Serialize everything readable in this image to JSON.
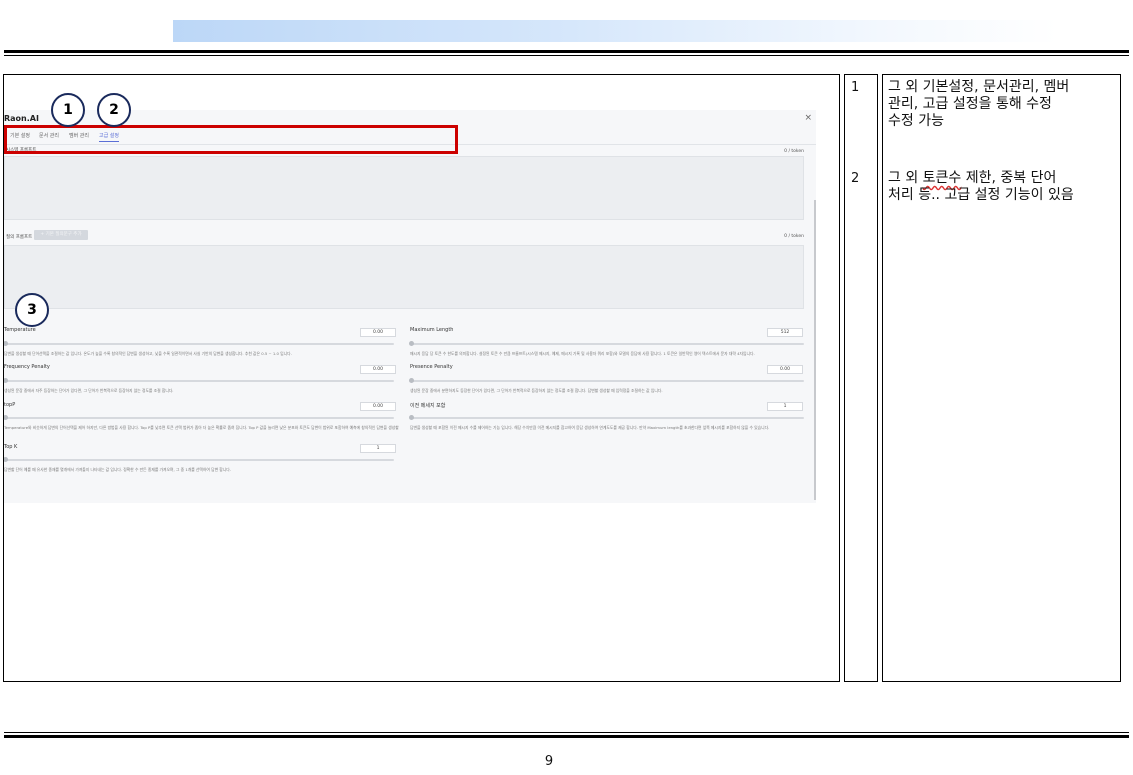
{
  "page_number": "9",
  "screenshot": {
    "app_title": "Raon.AI",
    "close_glyph": "×",
    "tabs": [
      "기본 설정",
      "문서 관리",
      "멤버 관리",
      "고급 설정"
    ],
    "active_tab_index": 3,
    "system_prompt_label": "시스템 프롬프트",
    "system_prompt_tokens": "0 / token",
    "user_prompt_label": "질의 프롬프트",
    "user_prompt_button": "+ 기본 질의문구 추가",
    "user_prompt_tokens": "0 / token",
    "params": [
      {
        "label": "Temperature",
        "value": "0.00",
        "desc": "답변을 생성할 때 단어선택을 조절하는 값 입니다. 온도가 높을 수록 창의적인 답변을 생성하고, 낮을 수록 일관적이면서 사실 기반의 답변을 생성합니다. 추천 값은 0.5 ~ 1.0 입니다."
      },
      {
        "label": "Maximum Length",
        "value": "512",
        "desc": "매시지 응답 당 토큰 수 한도를 의미합니다. 설정된 토큰 수 만큼 프롬프트(시스템 메시지, 예제, 메시지 기록 및 사용자 쿼리 포함)와 모델의 응답에 사용 합니다. 1 토큰은 일반적인 영어 텍스트에서 문자 대략 4자입니다."
      },
      {
        "label": "Frequency Penalty",
        "value": "0.00",
        "desc": "생성된 문장 중에서 자주 등장하는 단어가 있다면, 그 단어가 반복적으로 등장하지 않는 정도를 조절 합니다."
      },
      {
        "label": "Presence Penalty",
        "value": "0.00",
        "desc": "생성된 문장 중에서 분면하지도 등장한 단어가 있다면, 그 단어가 반복적으로 등장하지 않는 정도를 조절 합니다. 답변할 생성할 때 입력정을 조절하는 값 입니다."
      },
      {
        "label": "topP",
        "value": "0.00",
        "desc": "Temperature와 비슷하게 답변의 단어선택을 제어 하지만, 다른 방법을 사용 합니다. Top P를 낮추면 토큰 선택 범위가 좁아 더 높은 확률로 좁혀 집니다. Top P 값을 늘리면 낮은 분포와 토큰도 답변이 범위로 포함하여 예측에 창의적인 답변을 생성할 수 있습니다."
      },
      {
        "label": "이전 메세지 포함",
        "value": "1",
        "desc": "답변을 생성할 때 포함된 이전 메시지 수를 제어하는 기능 입니다. 해당 수치만큼 이전 메시지를 참고하여 응답 생성하여 연계도도를 제공 합니다. 만약 Maximum length를 초과한다면 앞쪽 메시지를 포함하지 않을 수 있습니다."
      },
      {
        "label": "Top K",
        "value": "1",
        "desc": "답변할 단어 예를 때 유사한 종재를 몇개에서 가져올지 나타내는 값 입니다. 정확한 수 만든 종재를 가져오며, 그 중 1개를 선택하여 답변 합니다."
      }
    ]
  },
  "markers": [
    "1",
    "2",
    "3"
  ],
  "notes": [
    {
      "num": "1",
      "line1": "그 외 기본설정, 문서관리, 멤버",
      "line2": "관리, 고급 설정을 통해 수정",
      "line3": "수정 가능"
    },
    {
      "num": "2",
      "prefix": "그 외 ",
      "wavy": "토큰수",
      "line1_rest": " 제한, 중복 단어",
      "line2": "처리 등.. 고급 설정 기능이 있음"
    }
  ]
}
